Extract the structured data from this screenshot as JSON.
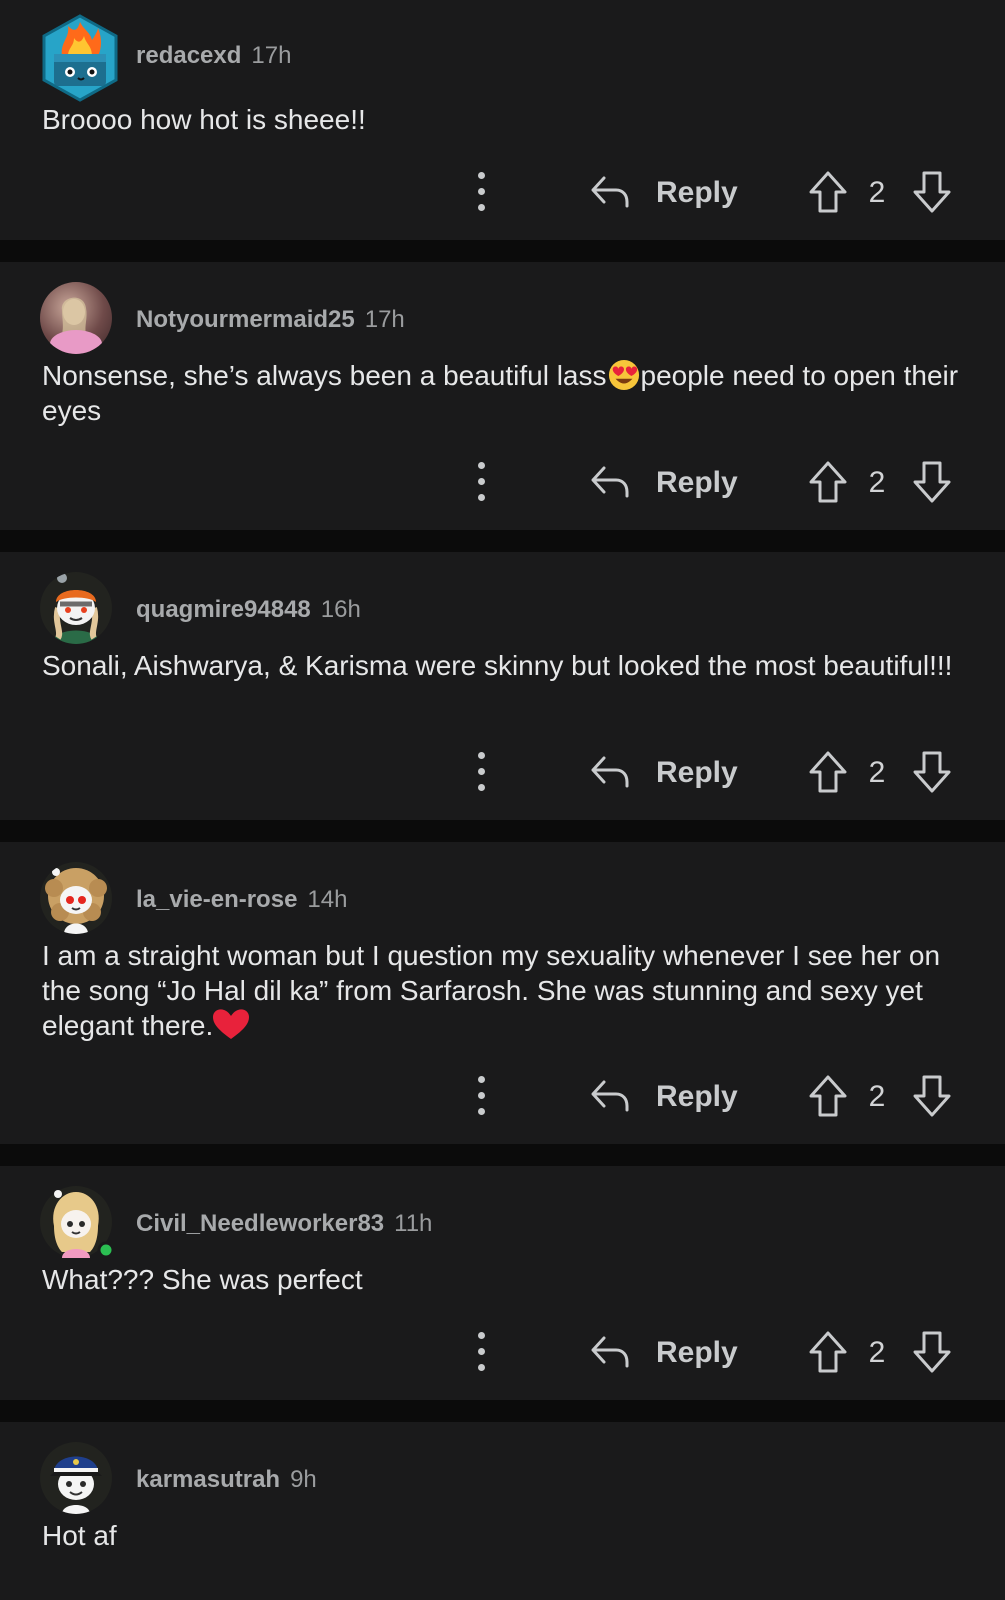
{
  "comments": [
    {
      "username": "redacexd",
      "time": "17h",
      "avatar": "dumpster-fire-avatar",
      "text": [
        "Broooo how hot is sheee!!"
      ],
      "reply_label": "Reply",
      "votes": "2"
    },
    {
      "username": "Notyourmermaid25",
      "time": "17h",
      "avatar": "photo-avatar",
      "text": [
        "Nonsense, she’s always been a beautiful lass",
        "people need to open their eyes"
      ],
      "emoji": "smiling-face-with-heart-eyes",
      "reply_label": "Reply",
      "votes": "2"
    },
    {
      "username": "quagmire94848",
      "time": "16h",
      "avatar": "snoo-avatar-orange",
      "text": [
        "Sonali, Aishwarya, & Karisma were skinny but looked the most beautiful!!!"
      ],
      "reply_label": "Reply",
      "votes": "2"
    },
    {
      "username": "la_vie-en-rose",
      "time": "14h",
      "avatar": "snoo-avatar-curly",
      "text": [
        "I am a straight woman but I question my sexuality whenever I see her on the song “Jo Hal dil ka” from Sarfarosh. She was stunning and sexy yet elegant there."
      ],
      "emoji": "red-heart",
      "reply_label": "Reply",
      "votes": "2"
    },
    {
      "username": "Civil_Needleworker83",
      "time": "11h",
      "avatar": "snoo-avatar-blonde",
      "online": true,
      "text": [
        "What??? She was perfect"
      ],
      "reply_label": "Reply",
      "votes": "2"
    },
    {
      "username": "karmasutrah",
      "time": "9h",
      "avatar": "snoo-avatar-captain",
      "text": [
        "Hot af"
      ]
    }
  ],
  "colors": {
    "page_bg": "#0b0b0b",
    "card_bg": "#1a1a1b",
    "meta_text": "#9a9c9e",
    "body_text": "#e6e7e8",
    "online_dot": "#2bbf52"
  }
}
